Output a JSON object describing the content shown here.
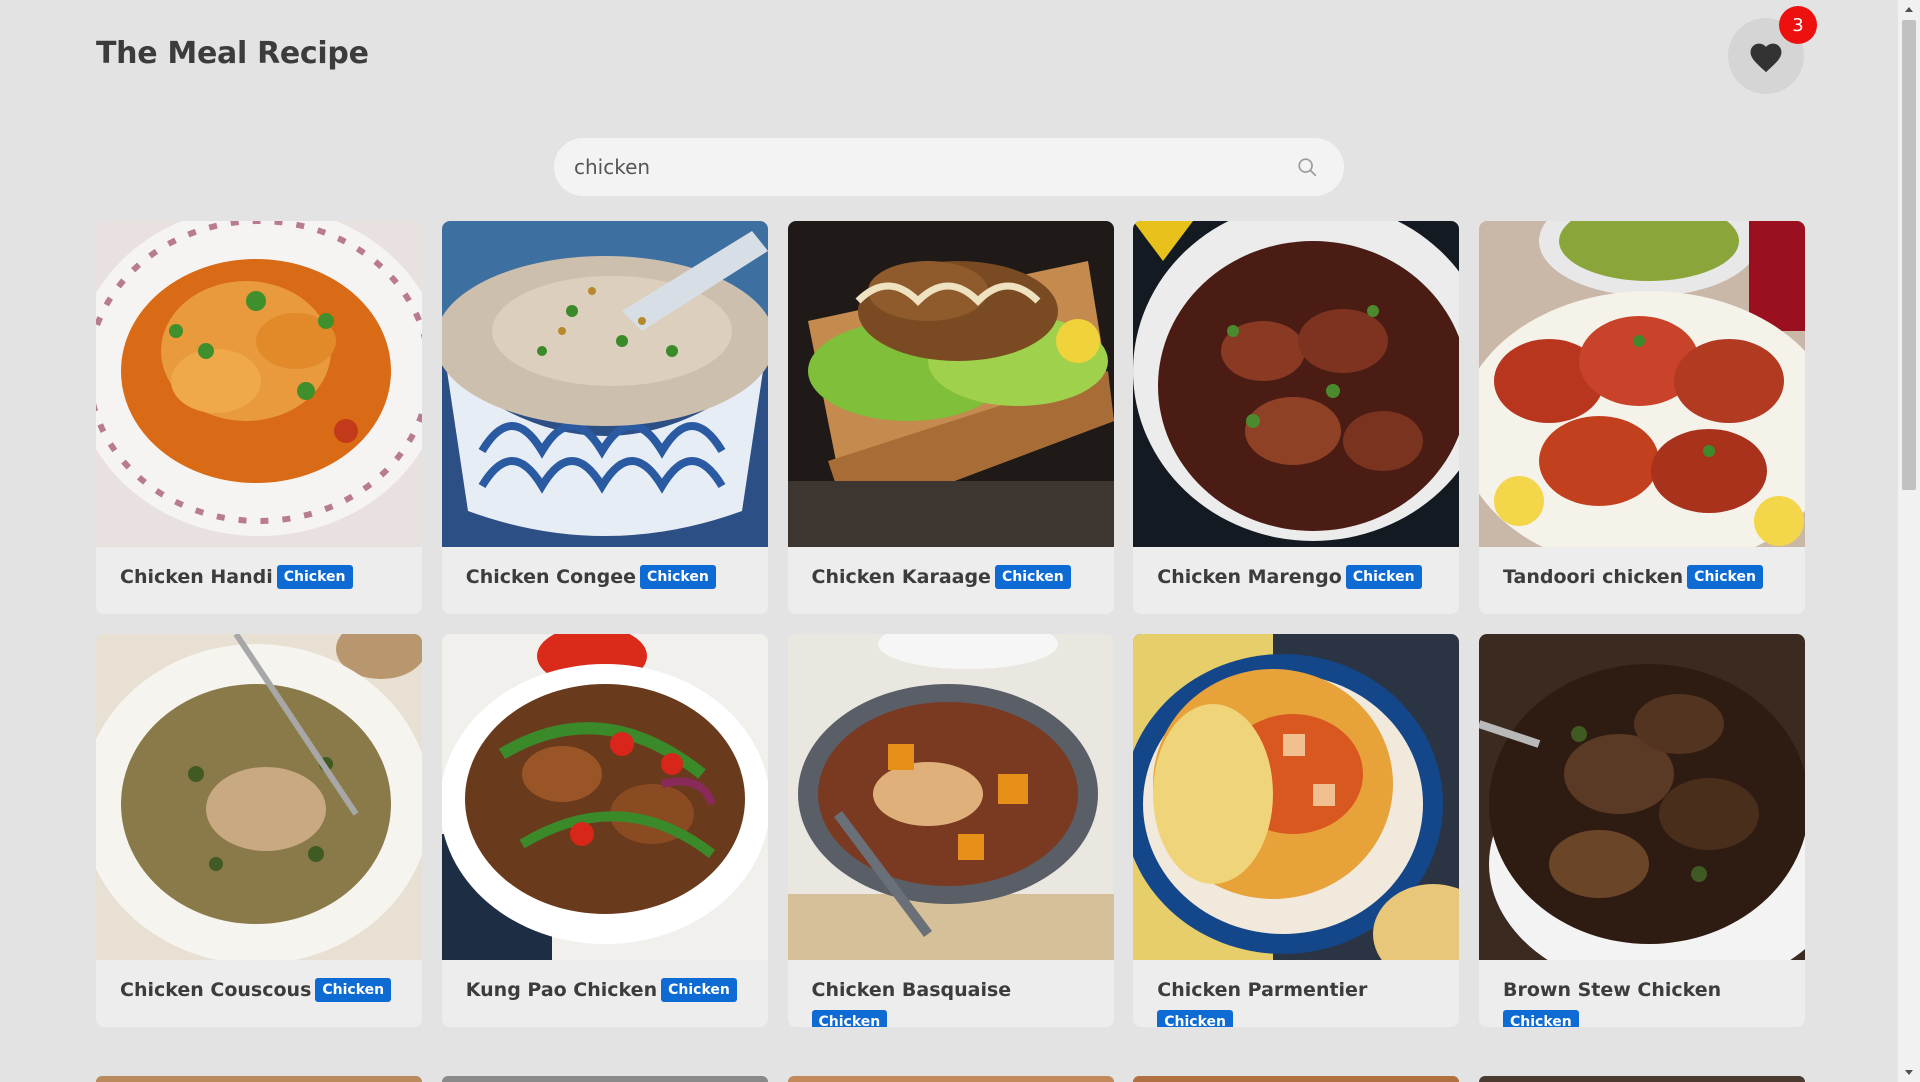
{
  "header": {
    "title": "The Meal Recipe",
    "favorites_icon": "heart-icon",
    "favorites_count": "3"
  },
  "search": {
    "value": "chicken",
    "icon": "search-icon"
  },
  "meals": [
    {
      "name": "Chicken Handi",
      "category": "Chicken"
    },
    {
      "name": "Chicken Congee",
      "category": "Chicken"
    },
    {
      "name": "Chicken Karaage",
      "category": "Chicken"
    },
    {
      "name": "Chicken Marengo",
      "category": "Chicken"
    },
    {
      "name": "Tandoori chicken",
      "category": "Chicken"
    },
    {
      "name": "Chicken Couscous",
      "category": "Chicken"
    },
    {
      "name": "Kung Pao Chicken",
      "category": "Chicken"
    },
    {
      "name": "Chicken Basquaise",
      "category": "Chicken"
    },
    {
      "name": "Chicken Parmentier",
      "category": "Chicken"
    },
    {
      "name": "Brown Stew Chicken",
      "category": "Chicken"
    }
  ],
  "colors": {
    "background": "#e3e3e3",
    "card": "#ededed",
    "tag": "#0e6bd4",
    "badge": "#ee0f0f"
  }
}
